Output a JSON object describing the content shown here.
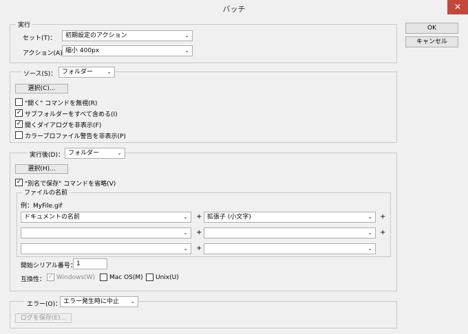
{
  "window": {
    "title": "バッチ",
    "close_glyph": "✕"
  },
  "buttons": {
    "ok": "OK",
    "cancel": "キャンセル"
  },
  "run": {
    "legend": "実行",
    "set_label": "セット(T)：",
    "set_value": "初期設定のアクション",
    "action_label": "アクション(A)：",
    "action_value": "縮小 400px"
  },
  "source": {
    "label": "ソース(S)：",
    "value": "フォルダー",
    "choose": "選択(C)...",
    "checks": [
      {
        "label": "\"開く\" コマンドを無視(R)",
        "checked": false
      },
      {
        "label": "サブフォルダーをすべて含める(I)",
        "checked": true
      },
      {
        "label": "開くダイアログを非表示(F)",
        "checked": true
      },
      {
        "label": "カラープロファイル警告を非表示(P)",
        "checked": false
      }
    ]
  },
  "dest": {
    "label": "実行後(D)：",
    "value": "フォルダー",
    "choose": "選択(H)...",
    "omit_saveas": {
      "label": "\"別名で保存\" コマンドを省略(V)",
      "checked": true
    },
    "naming": {
      "legend": "ファイルの名前",
      "example": "例：MyFile.gif",
      "row1_left": "ドキュメントの名前",
      "row1_right": "拡張子 (小文字)",
      "row2_left": "",
      "row2_right": "",
      "row3_left": "",
      "row3_right": "",
      "plus": "+"
    },
    "serial_label": "開始シリアル番号：",
    "serial_value": "1",
    "compat_label": "互換性：",
    "compat": [
      {
        "label": "Windows(W)",
        "checked": true,
        "disabled": true
      },
      {
        "label": "Mac OS(M)",
        "checked": false,
        "disabled": false
      },
      {
        "label": "Unix(U)",
        "checked": false,
        "disabled": false
      }
    ]
  },
  "errors": {
    "label": "エラー(O)：",
    "value": "エラー発生時に中止",
    "save_log": "ログを保存(E)..."
  }
}
